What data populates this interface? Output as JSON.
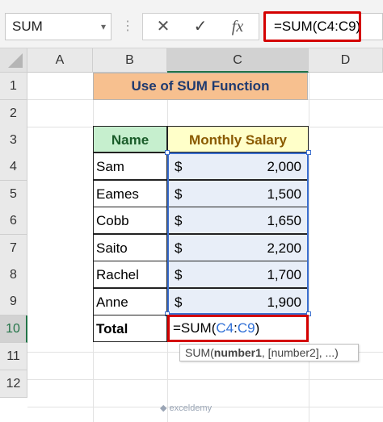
{
  "formula_bar": {
    "name_box": "SUM",
    "cancel_icon": "✕",
    "enter_icon": "✓",
    "fx_icon": "fx",
    "formula": "=SUM(C4:C9)"
  },
  "columns": [
    "A",
    "B",
    "C",
    "D"
  ],
  "rows": [
    "1",
    "2",
    "3",
    "4",
    "5",
    "6",
    "7",
    "8",
    "9",
    "10",
    "11",
    "12"
  ],
  "title": "Use of SUM Function",
  "table": {
    "headers": {
      "name": "Name",
      "salary": "Monthly Salary"
    },
    "rows": [
      {
        "name": "Sam",
        "currency": "$",
        "amount": "2,000"
      },
      {
        "name": "Eames",
        "currency": "$",
        "amount": "1,500"
      },
      {
        "name": "Cobb",
        "currency": "$",
        "amount": "1,650"
      },
      {
        "name": "Saito",
        "currency": "$",
        "amount": "2,200"
      },
      {
        "name": "Rachel",
        "currency": "$",
        "amount": "1,700"
      },
      {
        "name": "Anne",
        "currency": "$",
        "amount": "1,900"
      }
    ],
    "total_label": "Total",
    "edit_formula": {
      "prefix": "=SUM(",
      "ref_start": "C4",
      "colon": ":",
      "ref_end": "C9",
      "suffix": ")"
    }
  },
  "tooltip": {
    "func": "SUM(",
    "arg1": "number1",
    "rest": ", [number2], ...)"
  },
  "watermark": "exceldemy",
  "colors": {
    "title_fill": "#f7c08f",
    "name_header_fill": "#c6efce",
    "salary_header_fill": "#ffffc9",
    "highlight_red": "#d40000",
    "range_blue": "#3b6fcf"
  }
}
